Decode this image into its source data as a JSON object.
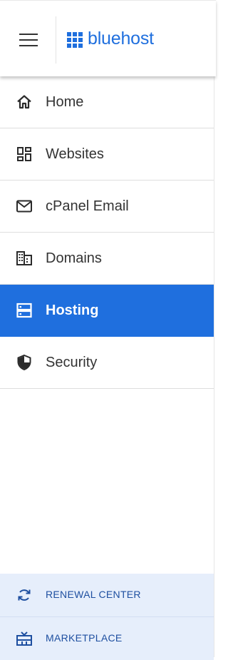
{
  "header": {
    "menu_icon": "hamburger-icon",
    "logo_text": "bluehost",
    "logo_icon": "bluehost-grid-logo",
    "brand_color": "#1f6fde"
  },
  "nav": {
    "items": [
      {
        "label": "Home",
        "icon": "home-icon",
        "active": false
      },
      {
        "label": "Websites",
        "icon": "websites-dashboard-icon",
        "active": false
      },
      {
        "label": "cPanel Email",
        "icon": "envelope-icon",
        "active": false
      },
      {
        "label": "Domains",
        "icon": "building-icon",
        "active": false
      },
      {
        "label": "Hosting",
        "icon": "server-icon",
        "active": true
      },
      {
        "label": "Security",
        "icon": "shield-icon",
        "active": false
      }
    ],
    "active_color": "#1f6fde"
  },
  "footer": {
    "renewal_label": "RENEWAL CENTER",
    "renewal_icon": "refresh-icon",
    "marketplace_label": "MARKETPLACE",
    "marketplace_icon": "marketplace-gift-icon",
    "background": "#e6eefb"
  }
}
